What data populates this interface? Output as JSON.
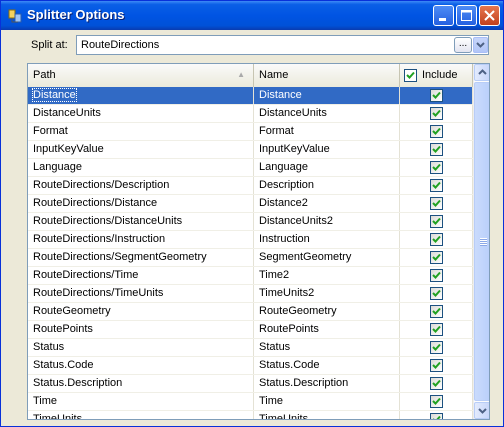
{
  "window": {
    "title": "Splitter Options",
    "icon": "app-icon"
  },
  "split": {
    "label": "Split at:",
    "value": "RouteDirections",
    "ellipsis_label": "..."
  },
  "grid": {
    "columns": {
      "path": "Path",
      "name": "Name",
      "include": "Include"
    },
    "header_include_checked": true,
    "selected_row": 0,
    "rows": [
      {
        "path": "Distance",
        "name": "Distance",
        "include": true
      },
      {
        "path": "DistanceUnits",
        "name": "DistanceUnits",
        "include": true
      },
      {
        "path": "Format",
        "name": "Format",
        "include": true
      },
      {
        "path": "InputKeyValue",
        "name": "InputKeyValue",
        "include": true
      },
      {
        "path": "Language",
        "name": "Language",
        "include": true
      },
      {
        "path": "RouteDirections/Description",
        "name": "Description",
        "include": true
      },
      {
        "path": "RouteDirections/Distance",
        "name": "Distance2",
        "include": true
      },
      {
        "path": "RouteDirections/DistanceUnits",
        "name": "DistanceUnits2",
        "include": true
      },
      {
        "path": "RouteDirections/Instruction",
        "name": "Instruction",
        "include": true
      },
      {
        "path": "RouteDirections/SegmentGeometry",
        "name": "SegmentGeometry",
        "include": true
      },
      {
        "path": "RouteDirections/Time",
        "name": "Time2",
        "include": true
      },
      {
        "path": "RouteDirections/TimeUnits",
        "name": "TimeUnits2",
        "include": true
      },
      {
        "path": "RouteGeometry",
        "name": "RouteGeometry",
        "include": true
      },
      {
        "path": "RoutePoints",
        "name": "RoutePoints",
        "include": true
      },
      {
        "path": "Status",
        "name": "Status",
        "include": true
      },
      {
        "path": "Status.Code",
        "name": "Status.Code",
        "include": true
      },
      {
        "path": "Status.Description",
        "name": "Status.Description",
        "include": true
      },
      {
        "path": "Time",
        "name": "Time",
        "include": true
      },
      {
        "path": "TimeUnits",
        "name": "TimeUnits",
        "include": true
      }
    ]
  }
}
